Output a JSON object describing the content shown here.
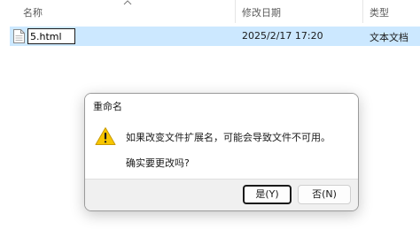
{
  "explorer": {
    "columns": {
      "name": "名称",
      "modified": "修改日期",
      "type": "类型"
    },
    "file": {
      "rename_value": "5.html",
      "modified": "2025/2/17 17:20",
      "type": "文本文档"
    }
  },
  "dialog": {
    "title": "重命名",
    "message": "如果改变文件扩展名，可能会导致文件不可用。",
    "question": "确实要更改吗?",
    "yes_label": "是(Y)",
    "no_label": "否(N)",
    "icon": "warning-icon"
  },
  "colors": {
    "selection": "#cce8ff",
    "warning": "#f7c600"
  }
}
